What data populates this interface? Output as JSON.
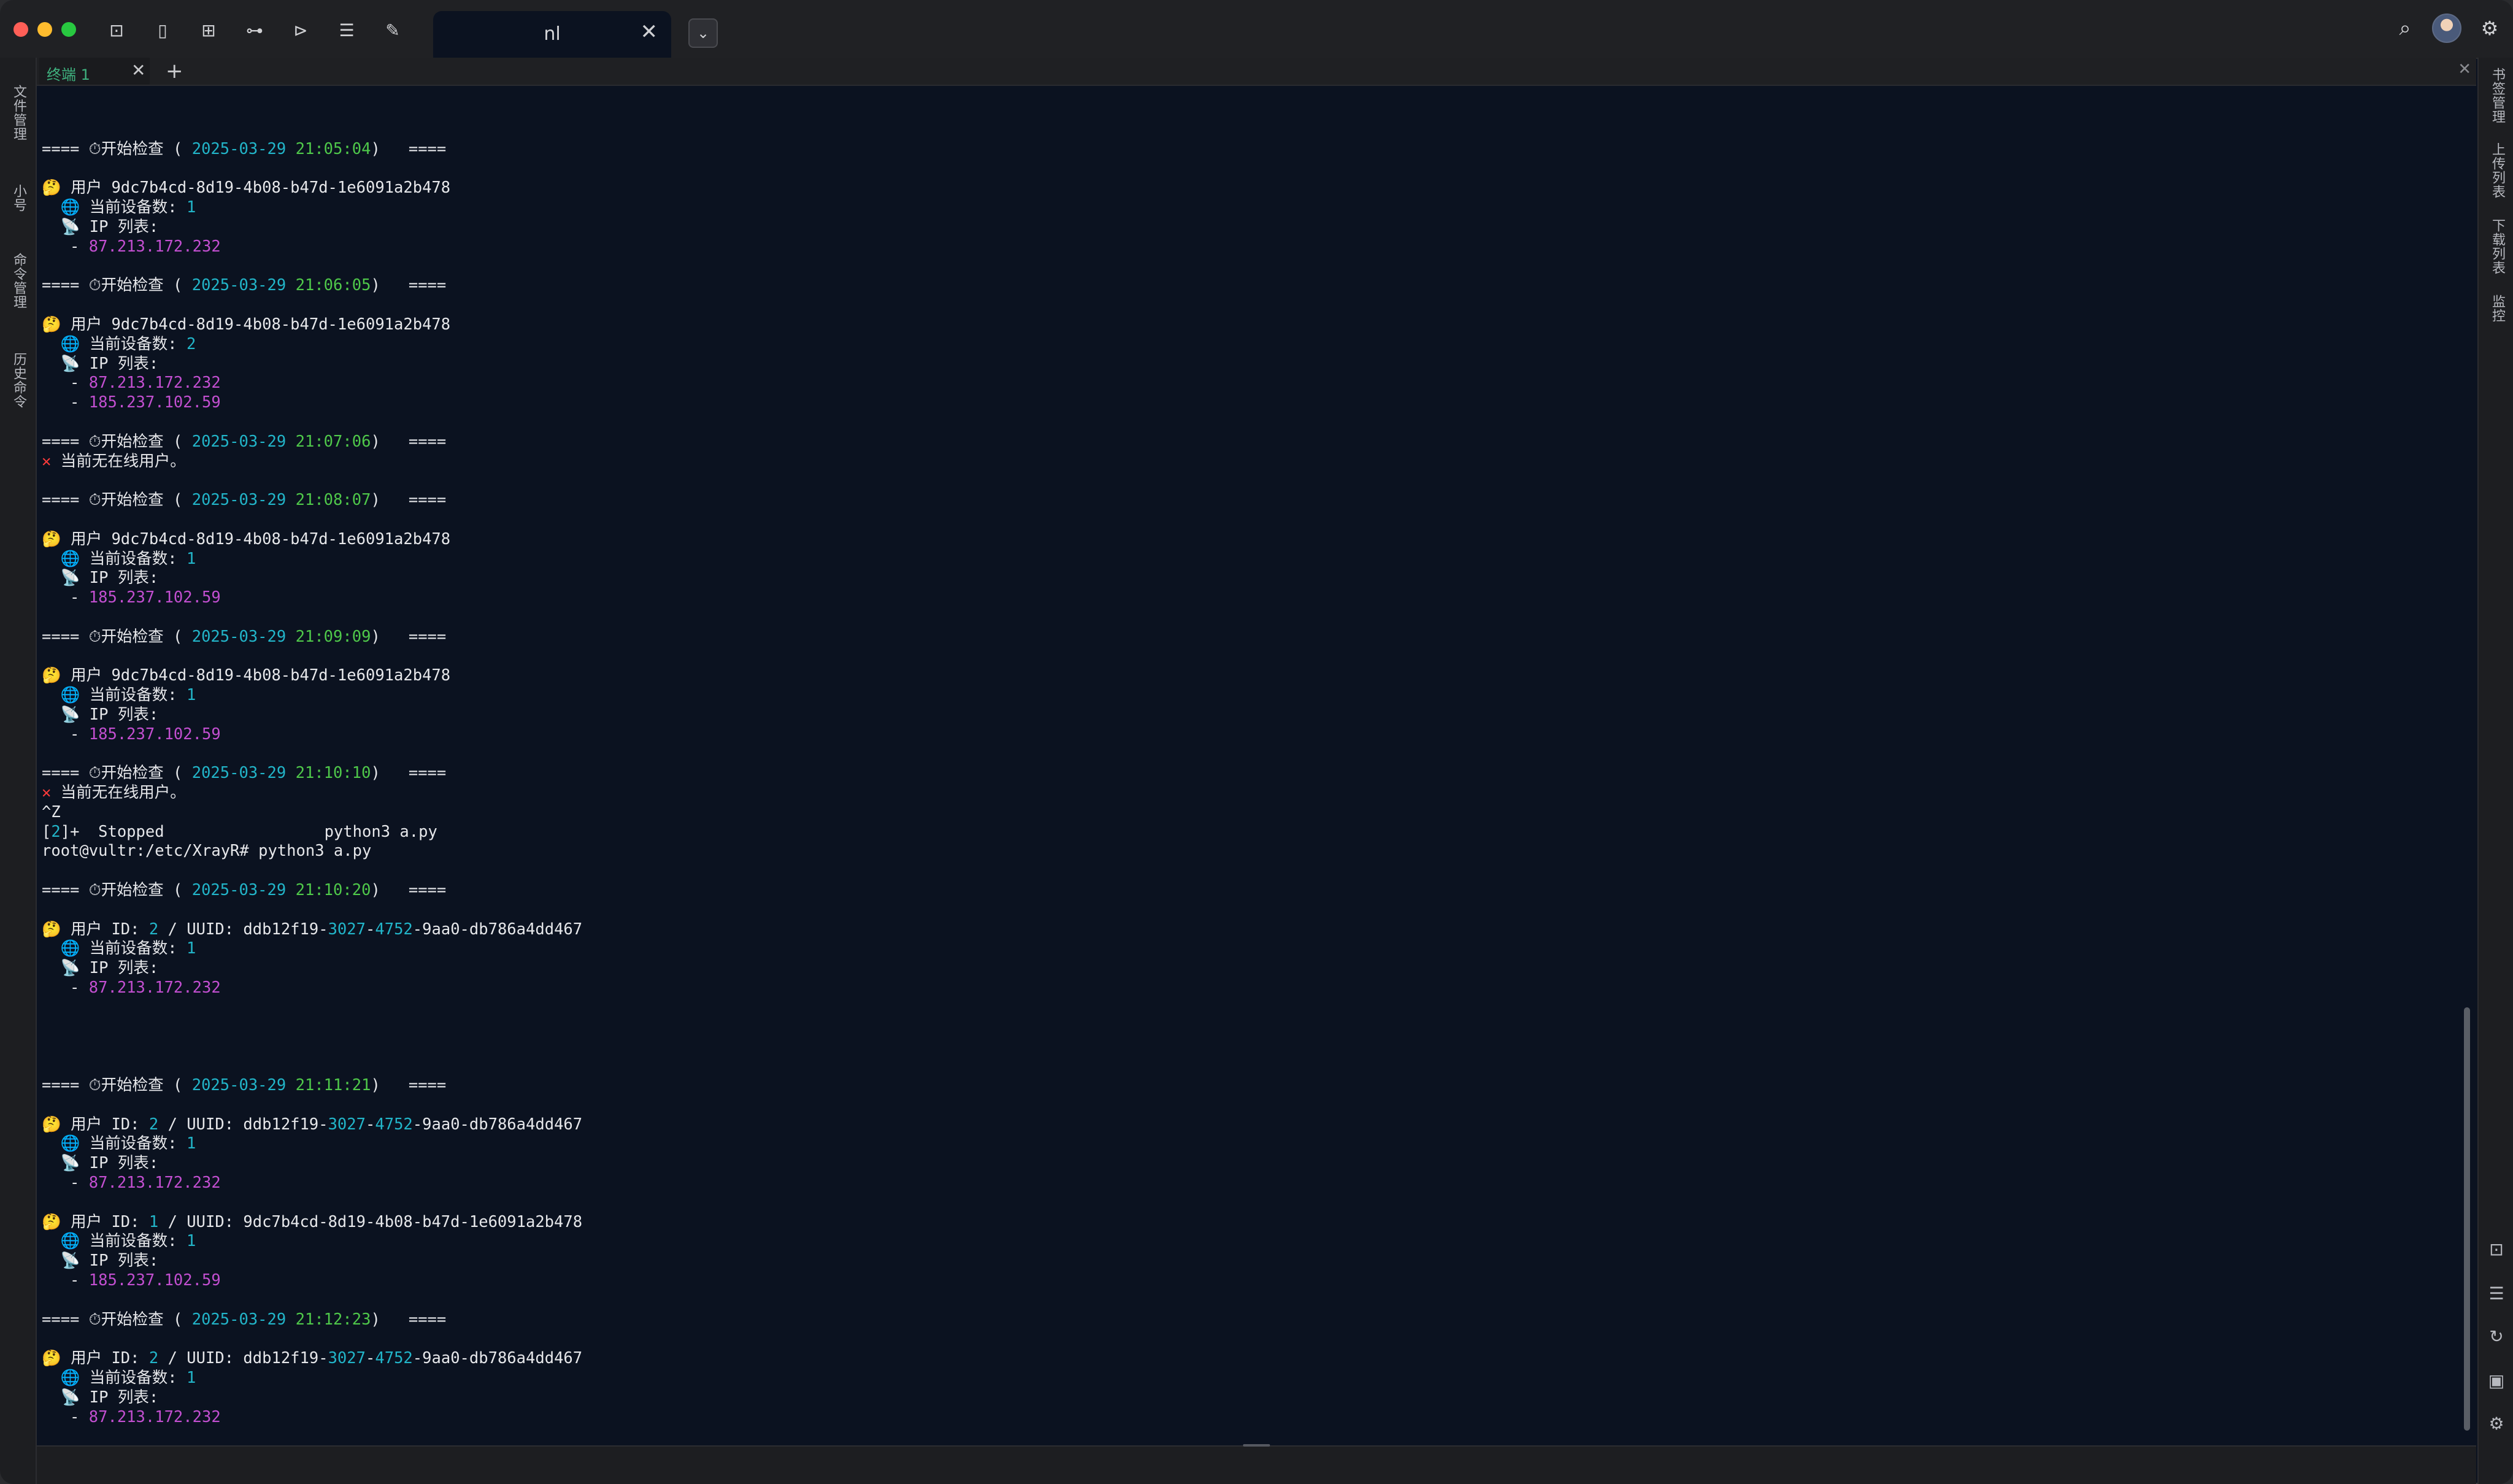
{
  "window": {
    "tab_title": "nl",
    "tab_close": "✕",
    "tab_dropdown": "⌄"
  },
  "toolbar": {
    "icons": [
      "new-terminal-icon",
      "document-icon",
      "layout-icon",
      "tree-icon",
      "shell-icon",
      "list-icon",
      "wrench-icon"
    ]
  },
  "left_sidebar": {
    "items": [
      "文件管理",
      "小号",
      "命令管理",
      "历史命令"
    ]
  },
  "right_sidebar": {
    "items": [
      "书签管理",
      "上传列表",
      "下载列表",
      "监控"
    ],
    "icons": [
      "terminal-icon",
      "list-icon",
      "refresh-icon",
      "save-icon",
      "gear-icon"
    ]
  },
  "session": {
    "tab_label": "终端 1",
    "close": "✕",
    "add": "+",
    "panel_close": "✕"
  },
  "colors": {
    "cyan": "#22b5c9",
    "green": "#4fc84a",
    "magenta": "#c24fd0",
    "red": "#ff3b3b",
    "background": "#0b1220"
  },
  "terminal": {
    "lines": [
      [],
      [
        {
          "t": "==== ⏱开始检查 ( "
        },
        {
          "t": "2025-03-29",
          "c": "cyan"
        },
        {
          "t": " "
        },
        {
          "t": "21:05:04",
          "c": "green"
        },
        {
          "t": ")   ===="
        }
      ],
      [],
      [
        {
          "t": "🤔 用户 9dc7b4cd-8d19-4b08-b47d-1e6091a2b478"
        }
      ],
      [
        {
          "t": "  🌐 当前设备数: "
        },
        {
          "t": "1",
          "c": "cyan"
        }
      ],
      [
        {
          "t": "  📡 IP 列表:"
        }
      ],
      [
        {
          "t": "   - "
        },
        {
          "t": "87.213.172.232",
          "c": "magenta"
        }
      ],
      [],
      [
        {
          "t": "==== ⏱开始检查 ( "
        },
        {
          "t": "2025-03-29",
          "c": "cyan"
        },
        {
          "t": " "
        },
        {
          "t": "21:06:05",
          "c": "green"
        },
        {
          "t": ")   ===="
        }
      ],
      [],
      [
        {
          "t": "🤔 用户 9dc7b4cd-8d19-4b08-b47d-1e6091a2b478"
        }
      ],
      [
        {
          "t": "  🌐 当前设备数: "
        },
        {
          "t": "2",
          "c": "cyan"
        }
      ],
      [
        {
          "t": "  📡 IP 列表:"
        }
      ],
      [
        {
          "t": "   - "
        },
        {
          "t": "87.213.172.232",
          "c": "magenta"
        }
      ],
      [
        {
          "t": "   - "
        },
        {
          "t": "185.237.102.59",
          "c": "magenta"
        }
      ],
      [],
      [
        {
          "t": "==== ⏱开始检查 ( "
        },
        {
          "t": "2025-03-29",
          "c": "cyan"
        },
        {
          "t": " "
        },
        {
          "t": "21:07:06",
          "c": "green"
        },
        {
          "t": ")   ===="
        }
      ],
      [
        {
          "t": "✕",
          "c": "red"
        },
        {
          "t": " 当前无在线用户。"
        }
      ],
      [],
      [
        {
          "t": "==== ⏱开始检查 ( "
        },
        {
          "t": "2025-03-29",
          "c": "cyan"
        },
        {
          "t": " "
        },
        {
          "t": "21:08:07",
          "c": "green"
        },
        {
          "t": ")   ===="
        }
      ],
      [],
      [
        {
          "t": "🤔 用户 9dc7b4cd-8d19-4b08-b47d-1e6091a2b478"
        }
      ],
      [
        {
          "t": "  🌐 当前设备数: "
        },
        {
          "t": "1",
          "c": "cyan"
        }
      ],
      [
        {
          "t": "  📡 IP 列表:"
        }
      ],
      [
        {
          "t": "   - "
        },
        {
          "t": "185.237.102.59",
          "c": "magenta"
        }
      ],
      [],
      [
        {
          "t": "==== ⏱开始检查 ( "
        },
        {
          "t": "2025-03-29",
          "c": "cyan"
        },
        {
          "t": " "
        },
        {
          "t": "21:09:09",
          "c": "green"
        },
        {
          "t": ")   ===="
        }
      ],
      [],
      [
        {
          "t": "🤔 用户 9dc7b4cd-8d19-4b08-b47d-1e6091a2b478"
        }
      ],
      [
        {
          "t": "  🌐 当前设备数: "
        },
        {
          "t": "1",
          "c": "cyan"
        }
      ],
      [
        {
          "t": "  📡 IP 列表:"
        }
      ],
      [
        {
          "t": "   - "
        },
        {
          "t": "185.237.102.59",
          "c": "magenta"
        }
      ],
      [],
      [
        {
          "t": "==== ⏱开始检查 ( "
        },
        {
          "t": "2025-03-29",
          "c": "cyan"
        },
        {
          "t": " "
        },
        {
          "t": "21:10:10",
          "c": "green"
        },
        {
          "t": ")   ===="
        }
      ],
      [
        {
          "t": "✕",
          "c": "red"
        },
        {
          "t": " 当前无在线用户。"
        }
      ],
      [
        {
          "t": "^Z"
        }
      ],
      [
        {
          "t": "["
        },
        {
          "t": "2",
          "c": "cyan"
        },
        {
          "t": "]+  Stopped                 python3 a.py"
        }
      ],
      [
        {
          "t": "root@vultr:/etc/XrayR# python3 a.py"
        }
      ],
      [],
      [
        {
          "t": "==== ⏱开始检查 ( "
        },
        {
          "t": "2025-03-29",
          "c": "cyan"
        },
        {
          "t": " "
        },
        {
          "t": "21:10:20",
          "c": "green"
        },
        {
          "t": ")   ===="
        }
      ],
      [],
      [
        {
          "t": "🤔 用户 ID: "
        },
        {
          "t": "2",
          "c": "cyan"
        },
        {
          "t": " / UUID: ddb12f19-"
        },
        {
          "t": "3027",
          "c": "cyan"
        },
        {
          "t": "-"
        },
        {
          "t": "4752",
          "c": "cyan"
        },
        {
          "t": "-9aa0-db786a4dd467"
        }
      ],
      [
        {
          "t": "  🌐 当前设备数: "
        },
        {
          "t": "1",
          "c": "cyan"
        }
      ],
      [
        {
          "t": "  📡 IP 列表:"
        }
      ],
      [
        {
          "t": "   - "
        },
        {
          "t": "87.213.172.232",
          "c": "magenta"
        }
      ],
      [],
      [],
      [],
      [],
      [
        {
          "t": "==== ⏱开始检查 ( "
        },
        {
          "t": "2025-03-29",
          "c": "cyan"
        },
        {
          "t": " "
        },
        {
          "t": "21:11:21",
          "c": "green"
        },
        {
          "t": ")   ===="
        }
      ],
      [],
      [
        {
          "t": "🤔 用户 ID: "
        },
        {
          "t": "2",
          "c": "cyan"
        },
        {
          "t": " / UUID: ddb12f19-"
        },
        {
          "t": "3027",
          "c": "cyan"
        },
        {
          "t": "-"
        },
        {
          "t": "4752",
          "c": "cyan"
        },
        {
          "t": "-9aa0-db786a4dd467"
        }
      ],
      [
        {
          "t": "  🌐 当前设备数: "
        },
        {
          "t": "1",
          "c": "cyan"
        }
      ],
      [
        {
          "t": "  📡 IP 列表:"
        }
      ],
      [
        {
          "t": "   - "
        },
        {
          "t": "87.213.172.232",
          "c": "magenta"
        }
      ],
      [],
      [
        {
          "t": "🤔 用户 ID: "
        },
        {
          "t": "1",
          "c": "cyan"
        },
        {
          "t": " / UUID: 9dc7b4cd-8d19-4b08-b47d-1e6091a2b478"
        }
      ],
      [
        {
          "t": "  🌐 当前设备数: "
        },
        {
          "t": "1",
          "c": "cyan"
        }
      ],
      [
        {
          "t": "  📡 IP 列表:"
        }
      ],
      [
        {
          "t": "   - "
        },
        {
          "t": "185.237.102.59",
          "c": "magenta"
        }
      ],
      [],
      [
        {
          "t": "==== ⏱开始检查 ( "
        },
        {
          "t": "2025-03-29",
          "c": "cyan"
        },
        {
          "t": " "
        },
        {
          "t": "21:12:23",
          "c": "green"
        },
        {
          "t": ")   ===="
        }
      ],
      [],
      [
        {
          "t": "🤔 用户 ID: "
        },
        {
          "t": "2",
          "c": "cyan"
        },
        {
          "t": " / UUID: ddb12f19-"
        },
        {
          "t": "3027",
          "c": "cyan"
        },
        {
          "t": "-"
        },
        {
          "t": "4752",
          "c": "cyan"
        },
        {
          "t": "-9aa0-db786a4dd467"
        }
      ],
      [
        {
          "t": "  🌐 当前设备数: "
        },
        {
          "t": "1",
          "c": "cyan"
        }
      ],
      [
        {
          "t": "  📡 IP 列表:"
        }
      ],
      [
        {
          "t": "   - "
        },
        {
          "t": "87.213.172.232",
          "c": "magenta"
        }
      ]
    ]
  }
}
